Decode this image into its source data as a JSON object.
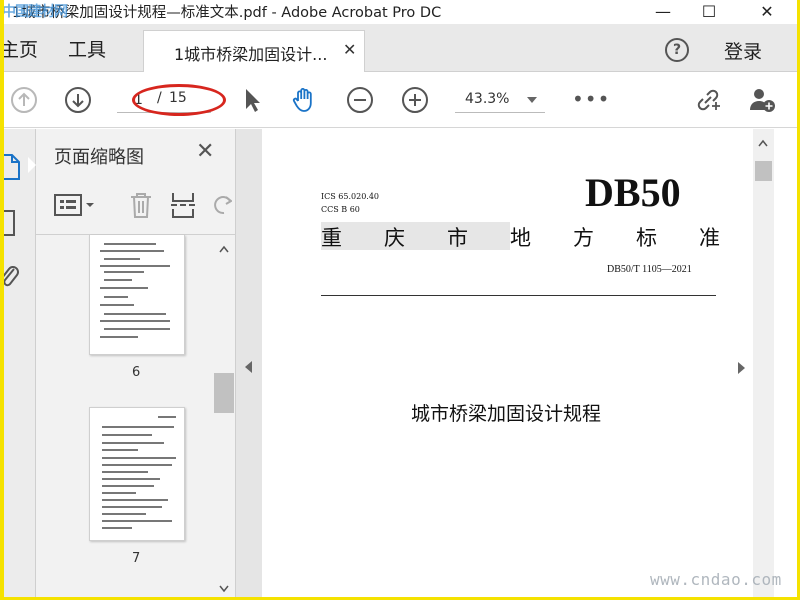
{
  "window": {
    "title": "1城市桥梁加固设计规程—标准文本.pdf - Adobe Acrobat Pro DC",
    "overlay_watermark": "中国建材网",
    "minimize": "—",
    "maximize": "☐",
    "close": "✕"
  },
  "tabs": {
    "home": "主页",
    "tools": "工具",
    "document": "1城市桥梁加固设计...",
    "document_close": "✕",
    "help": "?",
    "login": "登录"
  },
  "toolbar": {
    "current_page": "1",
    "page_separator": "/",
    "total_pages": "15",
    "zoom": "43.3%",
    "more": "•••",
    "icons": [
      "page-up-icon",
      "page-down-icon",
      "select-cursor-icon",
      "hand-tool-icon",
      "zoom-out-icon",
      "zoom-in-icon",
      "share-link-icon",
      "add-user-icon"
    ]
  },
  "highlight": {
    "color": "#d7261e"
  },
  "left_panel": {
    "title": "页面缩略图",
    "close": "✕",
    "thumbnails": [
      {
        "label": "6"
      },
      {
        "label": "7"
      }
    ]
  },
  "document": {
    "ics": "ICS 65.020.40",
    "ccs": "CCS  B  60",
    "code_big": "DB50",
    "standard_chars": [
      "重",
      "庆",
      "市",
      "地",
      "方",
      "标",
      "准"
    ],
    "std_number": "DB50/T 1105—2021",
    "title": "城市桥梁加固设计规程"
  },
  "watermark": "www.cndao.com",
  "colors": {
    "frame": "#f5e200",
    "accent_blue": "#1a73c7"
  }
}
